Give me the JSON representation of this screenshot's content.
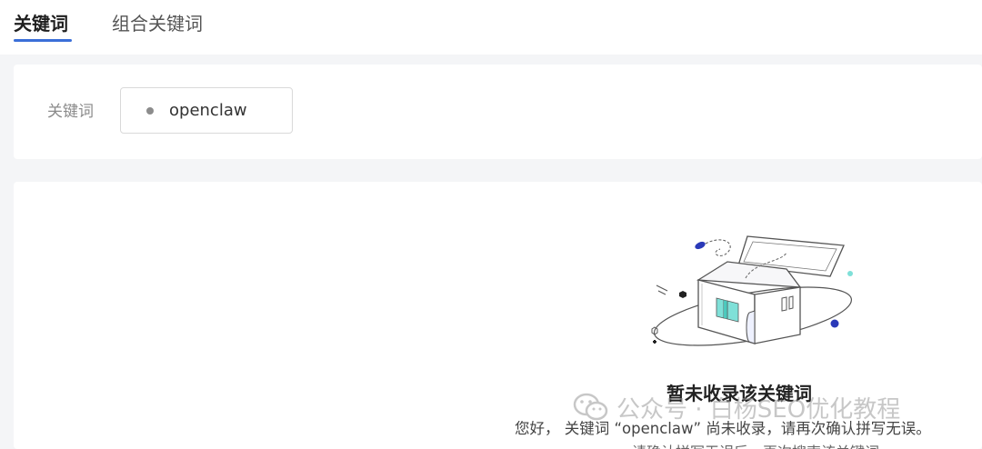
{
  "tabs": {
    "keyword": "关键词",
    "combo": "组合关键词"
  },
  "filter": {
    "label": "关键词",
    "keyword_value": "openclaw"
  },
  "empty_state": {
    "title": "暂未收录该关键词",
    "description": "您好， 关键词 “openclaw” 尚未收录，请再次确认拼写无误。",
    "description_cont": "请确认拼写无误后，再次搜索该关键词"
  },
  "watermark": {
    "text": "公众号 · 白杨SEO优化教程"
  },
  "colors": {
    "accent": "#3b6fd8",
    "teal": "#7fe0d8",
    "navy": "#2a39b8"
  },
  "icons": {
    "box": "empty-box-illustration",
    "wechat": "wechat-icon"
  }
}
